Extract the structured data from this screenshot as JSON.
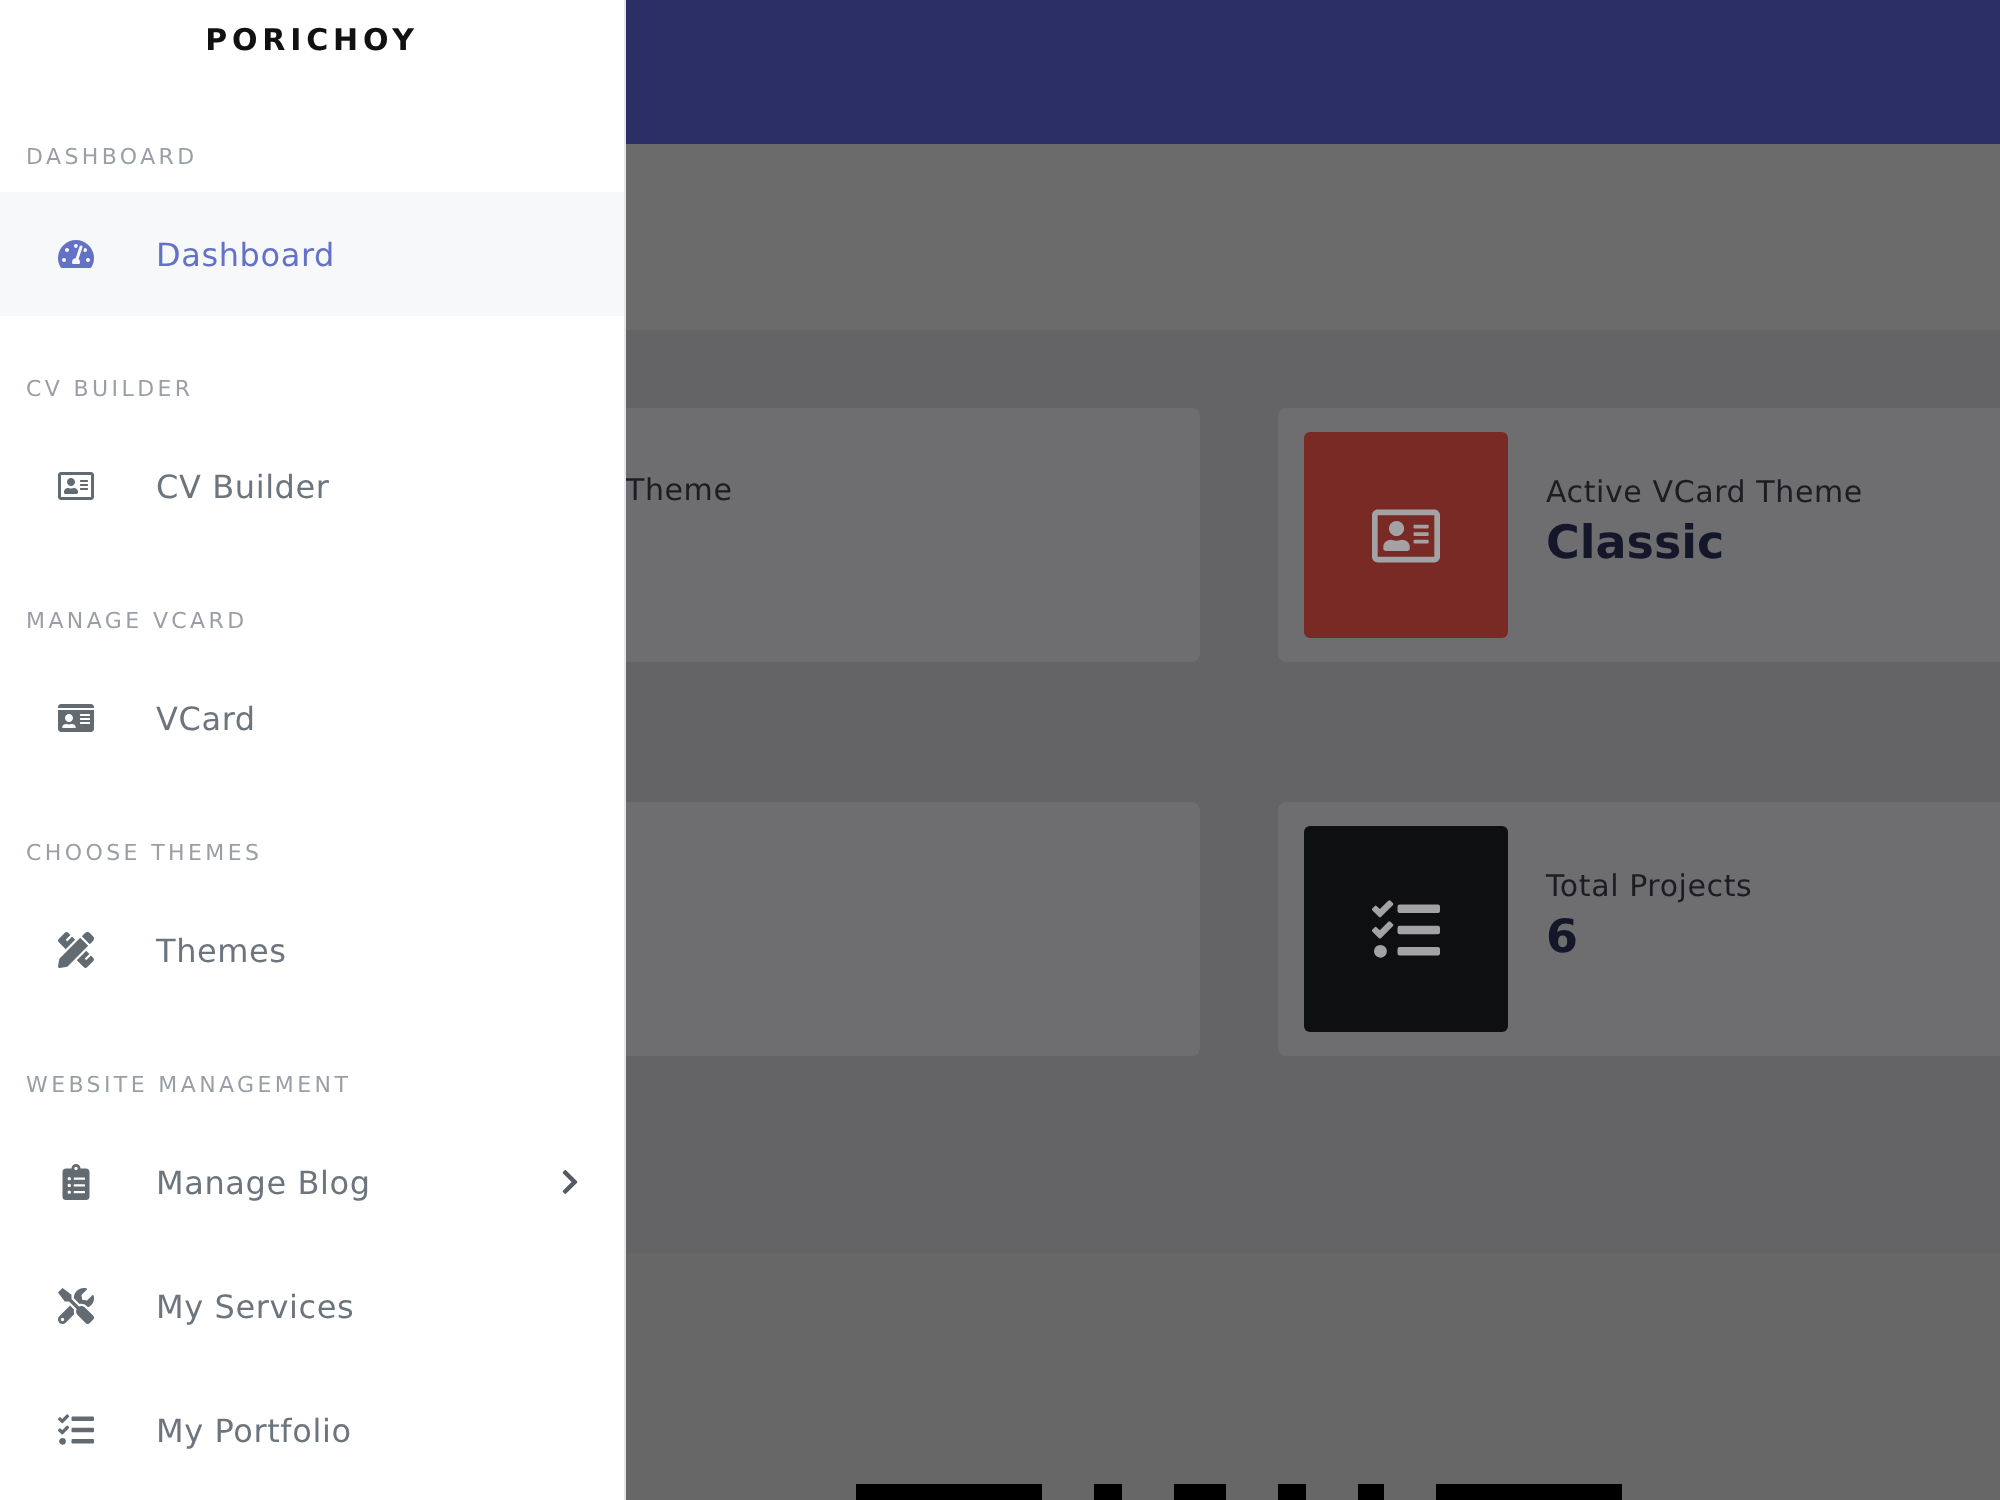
{
  "sidebar": {
    "logo": "PORICHOY",
    "sections": [
      {
        "heading": "DASHBOARD",
        "items": [
          {
            "label": "Dashboard",
            "selected": true,
            "submenu": false
          }
        ]
      },
      {
        "heading": "CV BUILDER",
        "items": [
          {
            "label": "CV Builder",
            "selected": false,
            "submenu": false
          }
        ]
      },
      {
        "heading": "MANAGE VCARD",
        "items": [
          {
            "label": "VCard",
            "selected": false,
            "submenu": false
          }
        ]
      },
      {
        "heading": "CHOOSE THEMES",
        "items": [
          {
            "label": "Themes",
            "selected": false,
            "submenu": false
          }
        ]
      },
      {
        "heading": "WEBSITE MANAGEMENT",
        "items": [
          {
            "label": "Manage Blog",
            "selected": false,
            "submenu": true
          },
          {
            "label": "My Services",
            "selected": false,
            "submenu": false
          },
          {
            "label": "My Portfolio",
            "selected": false,
            "submenu": false
          }
        ]
      }
    ]
  },
  "stat_cards": [
    {
      "kind": "plain",
      "label": "Theme"
    },
    {
      "kind": "tile",
      "label": "Active VCard Theme",
      "value": "Classic",
      "color": "#7a2a25"
    },
    {
      "kind": "plain"
    },
    {
      "kind": "tile",
      "label": "Total Projects",
      "value": "6",
      "color": "#0e0f11"
    }
  ]
}
